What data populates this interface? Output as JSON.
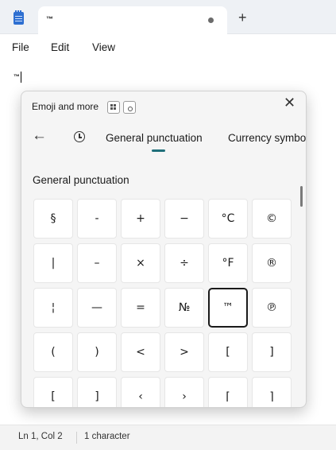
{
  "tab": {
    "title": "™",
    "new_tab": "+"
  },
  "menu": {
    "file": "File",
    "edit": "Edit",
    "view": "View"
  },
  "editor": {
    "content": "™"
  },
  "status": {
    "position": "Ln 1, Col 2",
    "count": "1 character"
  },
  "panel": {
    "title": "Emoji and more",
    "close": "✕",
    "back": "←",
    "categories": [
      "General punctuation",
      "Currency symbo"
    ],
    "section_title": "General punctuation",
    "selected_symbol": "™",
    "symbols": [
      [
        "§",
        "-",
        "+",
        "−",
        "°C",
        "©"
      ],
      [
        "|",
        "–",
        "×",
        "÷",
        "°F",
        "®"
      ],
      [
        "¦",
        "—",
        "=",
        "№",
        "™",
        "℗"
      ],
      [
        "(",
        ")",
        "<",
        ">",
        "[",
        "]"
      ],
      [
        "[",
        "]",
        "‹",
        "›",
        "⌈",
        "⌉"
      ]
    ]
  },
  "icons": {
    "app": "notepad-icon",
    "keyboard": "keyboard-icon",
    "settings": "circle-icon",
    "recent": "clock-icon",
    "back": "arrow-left-icon",
    "close": "close-icon"
  },
  "colors": {
    "accent_underline": "#1f6f7a",
    "titlebar": "#eef1f5"
  }
}
